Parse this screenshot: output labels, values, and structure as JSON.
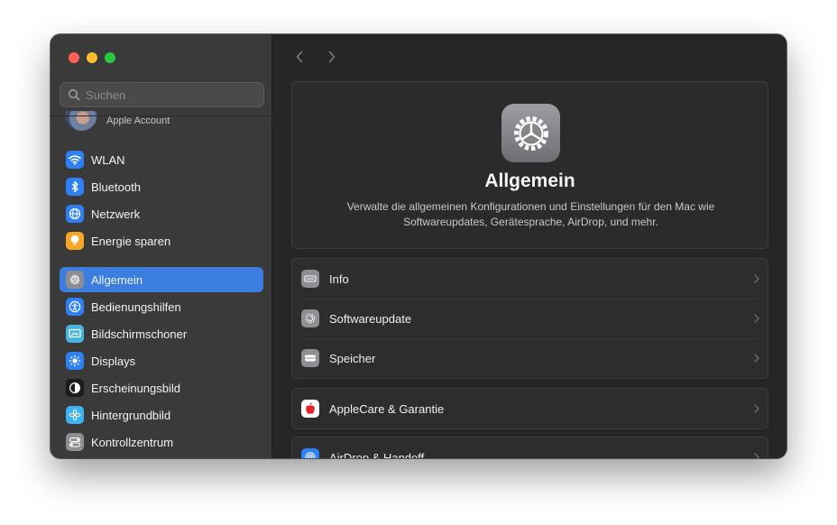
{
  "window": {
    "title": "Allgemein"
  },
  "sidebar": {
    "search_placeholder": "Suchen",
    "account_label": "Apple Account",
    "items": [
      {
        "label": "WLAN",
        "icon": "wifi-icon",
        "color": "#2f7ff5"
      },
      {
        "label": "Bluetooth",
        "icon": "bluetooth-icon",
        "color": "#2f7ff5"
      },
      {
        "label": "Netzwerk",
        "icon": "globe-icon",
        "color": "#2f7ff5"
      },
      {
        "label": "Energie sparen",
        "icon": "lightbulb-icon",
        "color": "#f6a623"
      },
      {
        "label": "Allgemein",
        "icon": "gear-icon",
        "color": "#8e8e93",
        "active": true
      },
      {
        "label": "Bedienungshilfen",
        "icon": "accessibility-icon",
        "color": "#2f7ff5"
      },
      {
        "label": "Bildschirmschoner",
        "icon": "screensaver-icon",
        "color": "#48b4e0"
      },
      {
        "label": "Displays",
        "icon": "sun-icon",
        "color": "#2f7ff5"
      },
      {
        "label": "Erscheinungsbild",
        "icon": "appearance-icon",
        "color": "#1c1c1e"
      },
      {
        "label": "Hintergrundbild",
        "icon": "flower-icon",
        "color": "#3fb3f0"
      },
      {
        "label": "Kontrollzentrum",
        "icon": "toggles-icon",
        "color": "#8e8e93"
      }
    ]
  },
  "main": {
    "hero": {
      "title": "Allgemein",
      "description": "Verwalte die allgemeinen Konfigurationen und Einstellungen für den Mac wie Softwareupdates, Gerätesprache, AirDrop, und mehr."
    },
    "groups": [
      {
        "rows": [
          {
            "label": "Info",
            "icon": "info-laptop-icon"
          },
          {
            "label": "Softwareupdate",
            "icon": "software-update-icon"
          },
          {
            "label": "Speicher",
            "icon": "storage-icon"
          }
        ]
      },
      {
        "rows": [
          {
            "label": "AppleCare & Garantie",
            "icon": "apple-icon"
          }
        ]
      },
      {
        "rows": [
          {
            "label": "AirDrop & Handoff",
            "icon": "airdrop-icon"
          }
        ]
      }
    ]
  }
}
